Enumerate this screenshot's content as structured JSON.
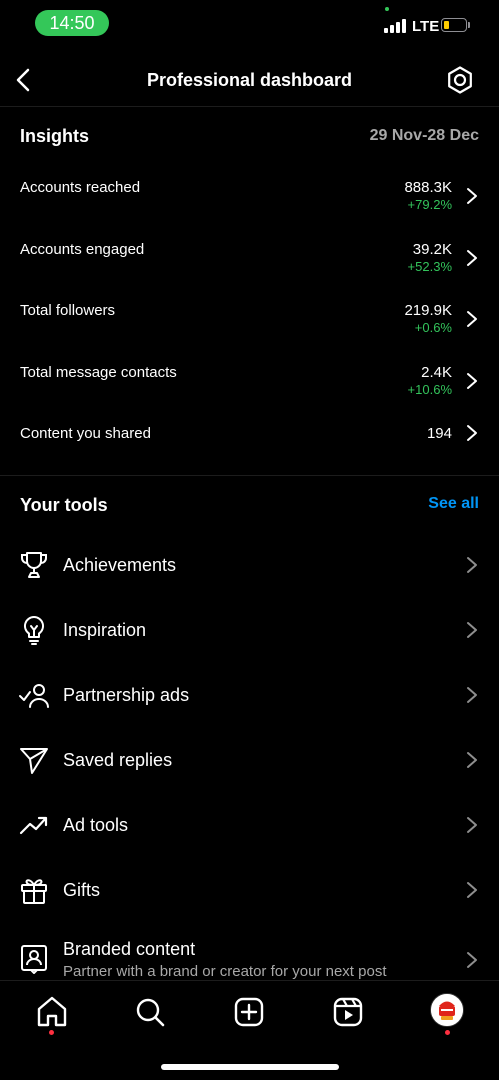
{
  "status_bar": {
    "time": "14:50",
    "network": "LTE"
  },
  "header": {
    "title": "Professional dashboard"
  },
  "insights": {
    "title": "Insights",
    "date_range": "29 Nov-28 Dec",
    "metrics": [
      {
        "label": "Accounts reached",
        "value": "888.3K",
        "change": "+79.2%"
      },
      {
        "label": "Accounts engaged",
        "value": "39.2K",
        "change": "+52.3%"
      },
      {
        "label": "Total followers",
        "value": "219.9K",
        "change": "+0.6%"
      },
      {
        "label": "Total message contacts",
        "value": "2.4K",
        "change": "+10.6%"
      },
      {
        "label": "Content you shared",
        "value": "194",
        "change": ""
      }
    ]
  },
  "tools": {
    "title": "Your tools",
    "see_all": "See all",
    "items": [
      {
        "label": "Achievements",
        "icon": "trophy-icon"
      },
      {
        "label": "Inspiration",
        "icon": "lightbulb-icon"
      },
      {
        "label": "Partnership ads",
        "icon": "partnership-icon"
      },
      {
        "label": "Saved replies",
        "icon": "paper-plane-icon"
      },
      {
        "label": "Ad tools",
        "icon": "trending-up-icon"
      },
      {
        "label": "Gifts",
        "icon": "gift-icon"
      },
      {
        "label": "Branded content",
        "subtitle": "Partner with a brand or creator for your next post",
        "icon": "branded-content-icon"
      }
    ]
  },
  "colors": {
    "accent": "#0095f6",
    "positive": "#33c35b",
    "notification": "#ff3040",
    "status_pill": "#34c759"
  }
}
